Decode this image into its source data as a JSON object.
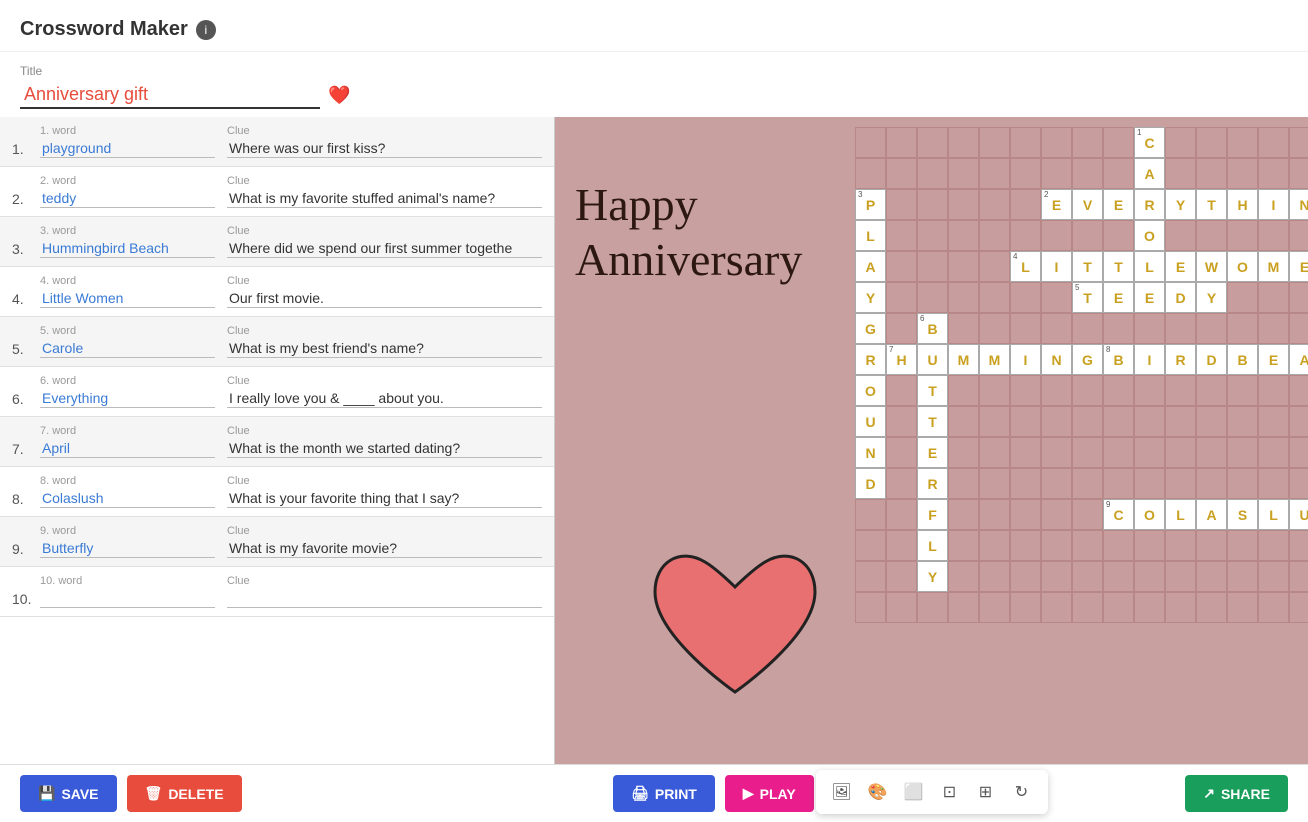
{
  "app": {
    "title": "Crossword Maker",
    "info_label": "i"
  },
  "puzzle": {
    "title_label": "Title",
    "title_value": "Anniversary gift",
    "heart": "❤️"
  },
  "words": [
    {
      "num": "1.",
      "num_label": "1. word",
      "word": "playground",
      "clue_label": "Clue",
      "clue": "Where was our first kiss?"
    },
    {
      "num": "2.",
      "num_label": "2. word",
      "word": "teddy",
      "clue_label": "Clue",
      "clue": "What is my favorite stuffed animal's name?"
    },
    {
      "num": "3.",
      "num_label": "3. word",
      "word": "Hummingbird Beach",
      "clue_label": "Clue",
      "clue": "Where did we spend our first summer togethe"
    },
    {
      "num": "4.",
      "num_label": "4. word",
      "word": "Little Women",
      "clue_label": "Clue",
      "clue": "Our first movie."
    },
    {
      "num": "5.",
      "num_label": "5. word",
      "word": "Carole",
      "clue_label": "Clue",
      "clue": "What is my best friend's name?"
    },
    {
      "num": "6.",
      "num_label": "6. word",
      "word": "Everything",
      "clue_label": "Clue",
      "clue": "I really love you & ____ about you."
    },
    {
      "num": "7.",
      "num_label": "7. word",
      "word": "April",
      "clue_label": "Clue",
      "clue": "What is the month we started dating?"
    },
    {
      "num": "8.",
      "num_label": "8. word",
      "word": "Colaslush",
      "clue_label": "Clue",
      "clue": "What is your favorite thing that I say?"
    },
    {
      "num": "9.",
      "num_label": "9. word",
      "word": "Butterfly",
      "clue_label": "Clue",
      "clue": "What is my favorite movie?"
    },
    {
      "num": "10.",
      "num_label": "10. word",
      "word": "",
      "clue_label": "Clue",
      "clue": ""
    }
  ],
  "buttons": {
    "save": "SAVE",
    "delete": "DELETE",
    "print": "PRINT",
    "play": "PLAY",
    "share": "SHARE"
  },
  "toolbar": {
    "image_icon": "🖼",
    "palette_icon": "🎨",
    "square_icon": "⬜",
    "grid_icon": "⊞",
    "table_icon": "⊟",
    "refresh_icon": "↻"
  },
  "anniversary_text_line1": "Happy",
  "anniversary_text_line2": "Anniversary"
}
